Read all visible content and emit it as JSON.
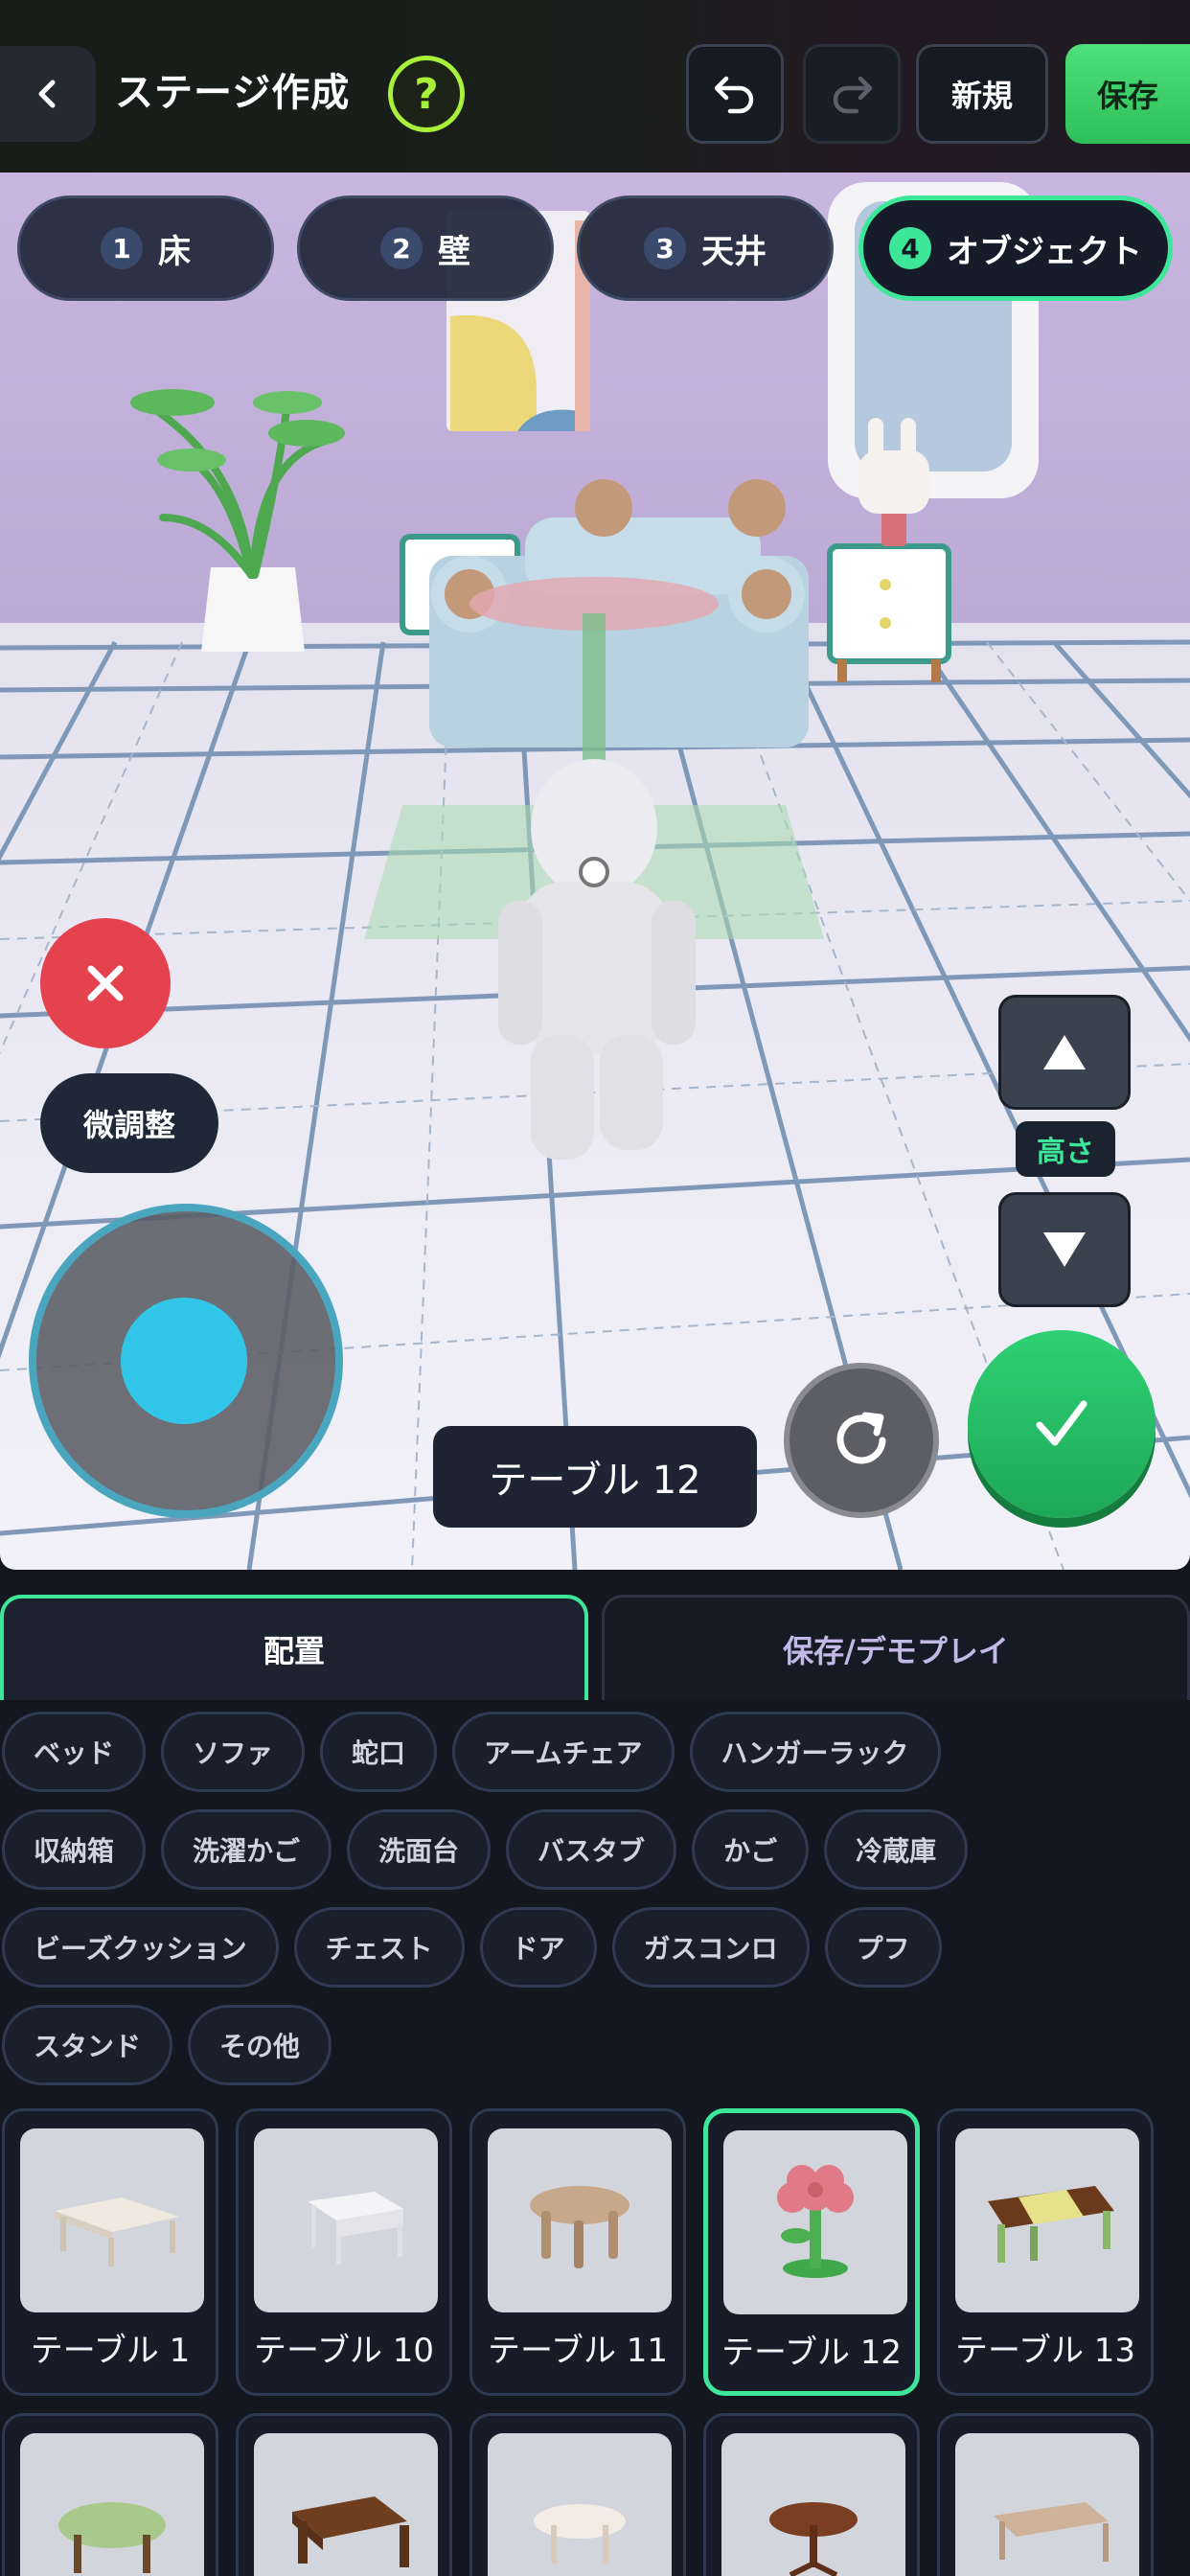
{
  "header": {
    "title": "ステージ作成",
    "help_label": "?",
    "new_label": "新規",
    "save_label": "保存"
  },
  "steps": [
    {
      "num": "1",
      "label": "床"
    },
    {
      "num": "2",
      "label": "壁"
    },
    {
      "num": "3",
      "label": "天井"
    },
    {
      "num": "4",
      "label": "オブジェクト",
      "active": true
    }
  ],
  "scene": {
    "finetune_label": "微調整",
    "height_label": "高さ",
    "selected_object": "テーブル 12"
  },
  "panel": {
    "tab_place": "配置",
    "tab_save": "保存/デモプレイ",
    "categories": [
      [
        "ベッド",
        "ソファ",
        "蛇口",
        "アームチェア",
        "ハンガーラック"
      ],
      [
        "収納箱",
        "洗濯かご",
        "洗面台",
        "バスタブ",
        "かご",
        "冷蔵庫"
      ],
      [
        "ビーズクッション",
        "チェスト",
        "ドア",
        "ガスコンロ",
        "プフ"
      ],
      [
        "スタンド",
        "その他"
      ]
    ],
    "items": [
      {
        "name": "テーブル 1"
      },
      {
        "name": "テーブル 10"
      },
      {
        "name": "テーブル 11"
      },
      {
        "name": "テーブル 12",
        "selected": true
      },
      {
        "name": "テーブル 13"
      }
    ]
  },
  "colors": {
    "accent": "#3ee69a",
    "help": "#a8f03a",
    "cancel": "#e5424f",
    "confirm": "#2ed073",
    "joystick": "#31c6e8"
  }
}
